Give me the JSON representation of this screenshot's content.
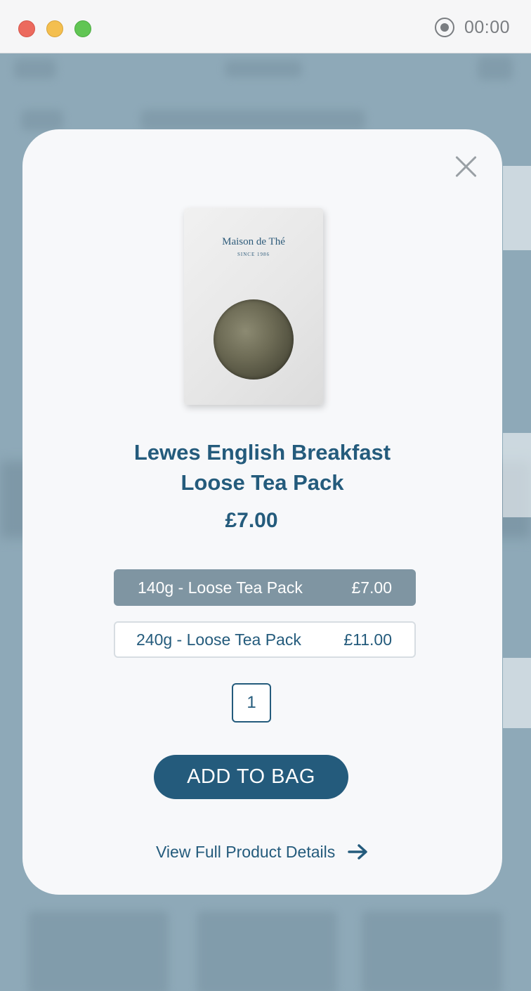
{
  "titlebar": {
    "recording_time": "00:00"
  },
  "modal": {
    "product": {
      "brand": "Maison de Thé",
      "brand_since": "SINCE 1986",
      "title_line1": "Lewes English Breakfast",
      "title_line2": "Loose Tea Pack",
      "price": "£7.00"
    },
    "variants": [
      {
        "label": "140g - Loose Tea Pack",
        "price": "£7.00",
        "selected": true
      },
      {
        "label": "240g - Loose Tea Pack",
        "price": "£11.00",
        "selected": false
      }
    ],
    "quantity": "1",
    "add_to_bag_label": "ADD TO BAG",
    "view_details_label": "View Full Product Details"
  },
  "colors": {
    "accent": "#245b7c",
    "selected_variant_bg": "#7f95a2",
    "overlay_bg": "#8aa6b6"
  },
  "icons": {
    "close": "close-icon",
    "arrow": "arrow-right-icon",
    "record": "record-icon"
  }
}
